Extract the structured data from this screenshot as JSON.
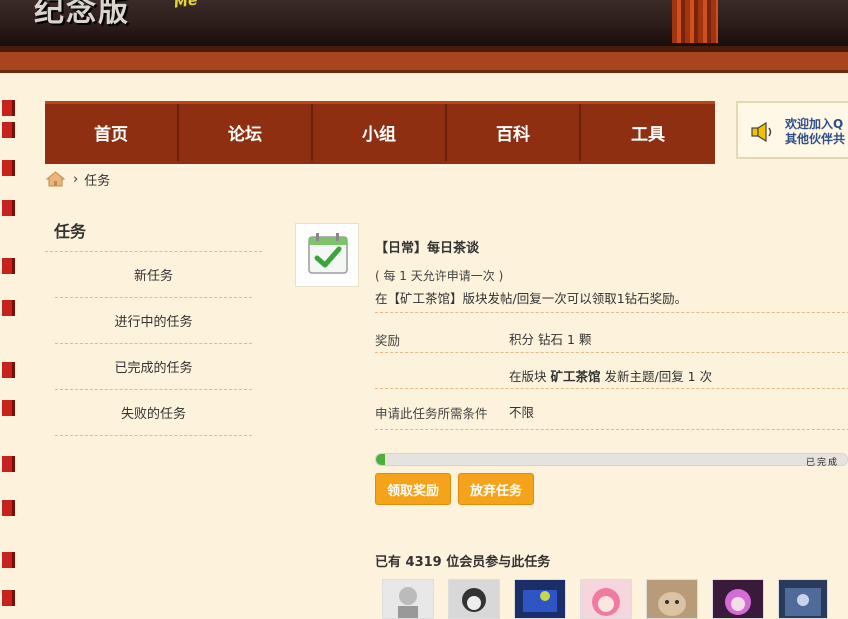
{
  "banner": {
    "logo_text": "纪念版",
    "logo_sub": "Me"
  },
  "nav": {
    "items": [
      {
        "label": "首页"
      },
      {
        "label": "论坛"
      },
      {
        "label": "小组"
      },
      {
        "label": "百科"
      },
      {
        "label": "工具"
      }
    ]
  },
  "notice": {
    "line1": "欢迎加入Q",
    "line2": "其他伙伴共"
  },
  "breadcrumb": {
    "separator": "›",
    "current": "任务"
  },
  "sidebar": {
    "title": "任务",
    "items": [
      {
        "label": "新任务"
      },
      {
        "label": "进行中的任务"
      },
      {
        "label": "已完成的任务"
      },
      {
        "label": "失败的任务"
      }
    ]
  },
  "task": {
    "title": "【日常】每日茶谈",
    "frequency": "( 每 1 天允许申请一次 )",
    "description": "在【矿工茶馆】版块发帖/回复一次可以领取1钻石奖励。",
    "reward_label": "奖励",
    "reward_value": "积分 钻石 1 颗",
    "condition_prefix": "在版块",
    "condition_forum": "矿工茶馆",
    "condition_suffix": "发新主题/回复 1 次",
    "requirement_label": "申请此任务所需条件",
    "requirement_value": "不限",
    "progress_percent": 2,
    "progress_text": "已完成",
    "claim_button": "领取奖励",
    "abandon_button": "放弃任务",
    "members_text": "已有 4319 位会员参与此任务"
  },
  "colors": {
    "nav_bg": "#8f2f12",
    "button": "#f5a31a",
    "reward": "#e07a10",
    "progress": "#4caf3a"
  }
}
